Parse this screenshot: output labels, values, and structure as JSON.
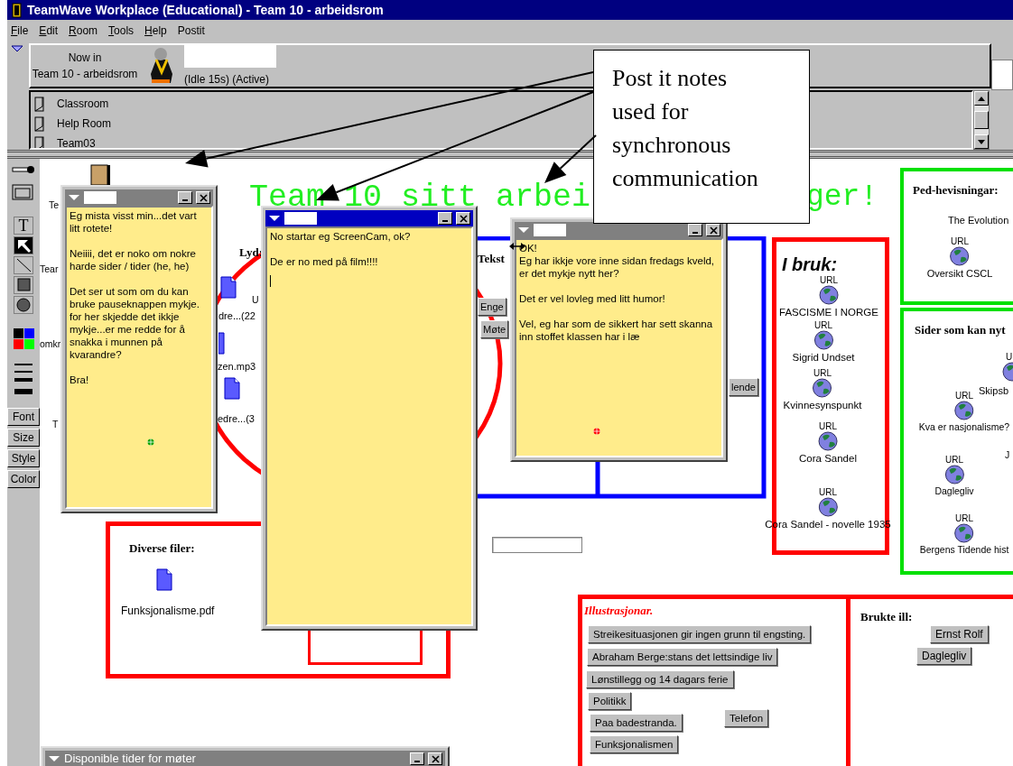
{
  "window": {
    "title": "TeamWave Workplace (Educational) - Team 10 - arbeidsrom"
  },
  "menu": [
    {
      "label": "File",
      "mnemonic": true
    },
    {
      "label": "Edit",
      "mnemonic": true
    },
    {
      "label": "Room",
      "mnemonic": true
    },
    {
      "label": "Tools",
      "mnemonic": true
    },
    {
      "label": "Help",
      "mnemonic": true
    },
    {
      "label": "Postit",
      "mnemonic": false
    }
  ],
  "presence": {
    "now_in": "Now in",
    "room": "Team 10 - arbeidsrom",
    "status": "(Idle 15s) (Active)"
  },
  "rooms": [
    "Classroom",
    "Help Room",
    "Team03"
  ],
  "tools": [
    {
      "kind": "connector",
      "selected": false
    },
    {
      "kind": "window",
      "selected": false
    },
    {
      "kind": "text",
      "label": "T",
      "selected": false
    },
    {
      "kind": "pointer",
      "selected": true
    },
    {
      "kind": "line",
      "selected": false
    },
    {
      "kind": "rect",
      "selected": false
    },
    {
      "kind": "circle",
      "selected": false
    }
  ],
  "colors": [
    {
      "color": "#000000"
    },
    {
      "color": "#0000ff"
    },
    {
      "color": "#ff0000"
    },
    {
      "color": "#00ff00"
    }
  ],
  "format_buttons": [
    "Font",
    "Size",
    "Style",
    "Color"
  ],
  "canvas": {
    "title_left": "Team 10 sitt arbei",
    "title_right": "ger!",
    "cut_labels": [
      "Te",
      "Tear",
      "omkr",
      "T",
      "U",
      "J"
    ],
    "lyd": {
      "heading": "Lyd:",
      "files": [
        "dre...(22",
        "zen.mp3",
        "edre...(3"
      ]
    },
    "tekst": {
      "heading": "Tekst",
      "buttons": [
        "Enge",
        "Møte",
        "lende"
      ]
    },
    "i_bruk": {
      "heading": "I bruk:",
      "links": [
        {
          "tag": "URL",
          "label": "FASCISME I NORGE"
        },
        {
          "tag": "URL",
          "label": "Sigrid Undset"
        },
        {
          "tag": "URL",
          "label": "Kvinnesynspunkt"
        },
        {
          "tag": "URL",
          "label": "Cora Sandel"
        },
        {
          "tag": "URL",
          "label": "Cora Sandel - novelle 1935"
        }
      ]
    },
    "ped": {
      "heading": "Ped-hevisningar:",
      "note": "The Evolution",
      "links": [
        {
          "tag": "URL",
          "label": "Oversikt CSCL"
        }
      ]
    },
    "sider": {
      "heading": "Sider som kan nyt",
      "links": [
        {
          "tag": "U",
          "label": "Skipsb"
        },
        {
          "tag": "URL",
          "label": "Kva er nasjonalisme?"
        },
        {
          "tag": "URL",
          "label": "Daglegliv"
        },
        {
          "tag": "URL",
          "label": "Bergens Tidende hist"
        }
      ]
    },
    "diverse": {
      "heading": "Diverse filer:",
      "files": [
        "Funksjonalisme.pdf"
      ]
    },
    "illustrasjonar": {
      "heading": "Illustrasjonar.",
      "buttons": [
        "Streikesituasjonen gir ingen grunn til engsting.",
        "Abraham Berge:stans det lettsindige liv",
        "Lønstillegg og 14 dagars ferie",
        "Politikk",
        "Paa badestranda.",
        "Telefon",
        "Funksjonalismen"
      ]
    },
    "brukte": {
      "heading": "Brukte ill:",
      "buttons": [
        "Ernst Rolf",
        "Daglegliv"
      ]
    }
  },
  "postits": [
    {
      "active": false,
      "cursor": false,
      "resize_cursor": false,
      "color": "#00a000",
      "text": "Eg mista visst min...det vart litt rotete!\n\nNeiiii, det er noko om nokre harde sider / tider (he, he)\n\nDet ser ut som om du kan bruke pauseknappen mykje. for her skjedde det ikkje mykje...er me redde for å snakka i munnen på kvarandre?\n\nBra!"
    },
    {
      "active": true,
      "cursor": true,
      "resize_cursor": false,
      "text": "No startar eg ScreenCam, ok?\n\nDe er no med på film!!!!"
    },
    {
      "active": false,
      "cursor": false,
      "resize_cursor": true,
      "color": "#ff0000",
      "text": "OK!\nEg har ikkje vore inne sidan fredags kveld, er det mykje nytt her?\n\nDet er vel lovleg med litt humor!\n\nVel, eg har som de sikkert har sett skanna inn stoffet klassen har i læ"
    }
  ],
  "meeting_window": {
    "title": "Disponible tider for møter"
  },
  "annotation": {
    "text": "Post it notes used for synchronous communication"
  }
}
